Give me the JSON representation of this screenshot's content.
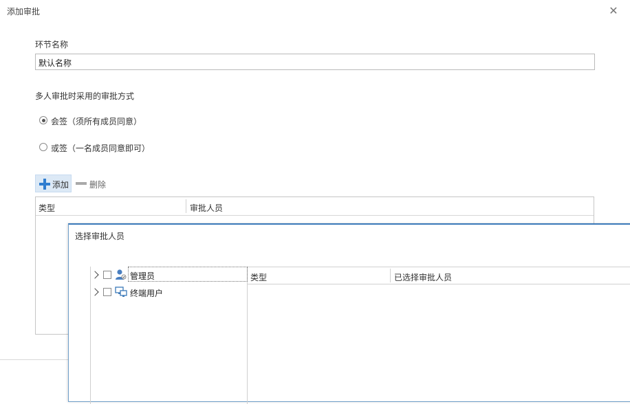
{
  "dialog": {
    "title": "添加审批"
  },
  "form": {
    "stage_name_label": "环节名称",
    "stage_name_value": "默认名称",
    "method_label": "多人审批时采用的审批方式",
    "options": [
      {
        "label": "会签（须所有成员同意）",
        "selected": true
      },
      {
        "label": "或签（一名成员同意即可）",
        "selected": false
      }
    ]
  },
  "toolbar": {
    "add_label": "添加",
    "delete_label": "删除"
  },
  "approvers_grid": {
    "columns": [
      "类型",
      "审批人员"
    ]
  },
  "picker": {
    "title": "选择审批人员",
    "tree_items": [
      {
        "label": "管理员",
        "icon": "admin-user-icon"
      },
      {
        "label": "终端用户",
        "icon": "terminal-user-icon"
      }
    ],
    "columns": [
      "类型",
      "已选择审批人员"
    ]
  },
  "colors": {
    "accent": "#2f7dd0",
    "selected_bg": "#dce9f6",
    "panel_border": "#3a78b8"
  }
}
